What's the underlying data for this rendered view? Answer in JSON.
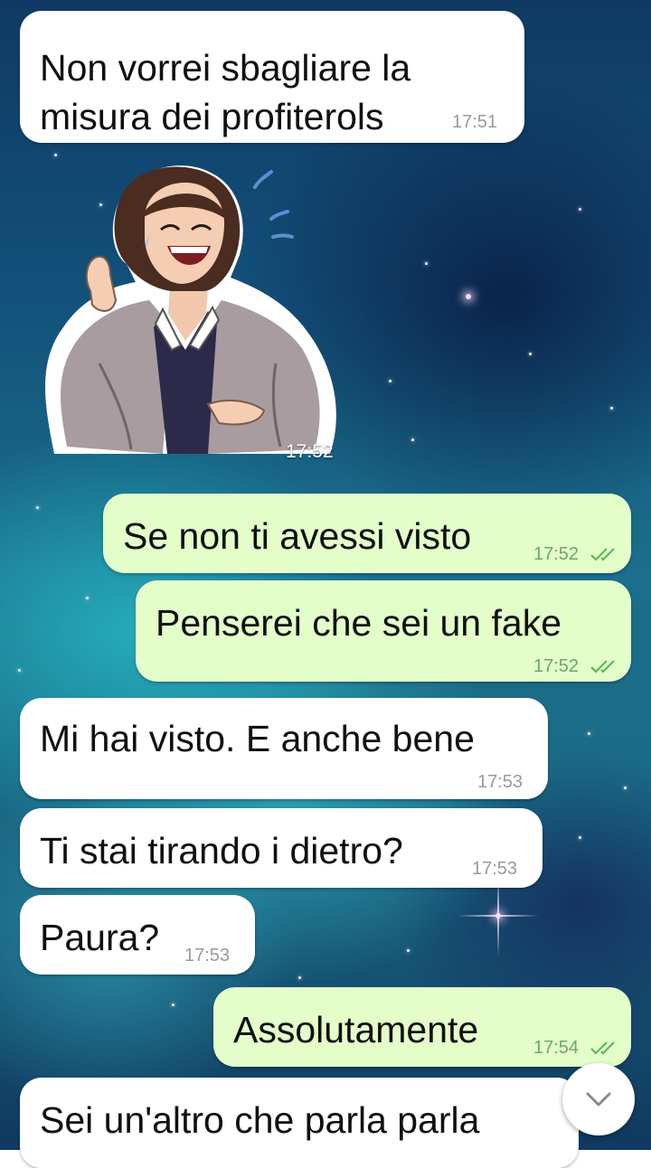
{
  "messages": [
    {
      "text_lines": [
        "Non vorrei sbagliare la",
        "misura dei profiterols"
      ],
      "time": "17:51",
      "direction": "incoming"
    },
    {
      "type": "sticker",
      "icon": "laughing-woman-sticker-icon",
      "time": "17:52",
      "direction": "incoming"
    },
    {
      "text": "Se non ti avessi visto",
      "time": "17:52",
      "direction": "outgoing",
      "status": "read"
    },
    {
      "text": "Penserei che sei un fake",
      "time": "17:52",
      "direction": "outgoing",
      "status": "read"
    },
    {
      "text": "Mi hai visto. E anche bene",
      "time": "17:53",
      "direction": "incoming"
    },
    {
      "text": "Ti stai tirando i dietro?",
      "time": "17:53",
      "direction": "incoming"
    },
    {
      "text": "Paura?",
      "time": "17:53",
      "direction": "incoming"
    },
    {
      "text": "Assolutamente",
      "time": "17:54",
      "direction": "outgoing",
      "status": "read"
    },
    {
      "text": "Sei un'altro che parla parla",
      "direction": "incoming"
    }
  ],
  "scroll_button": {
    "icon": "chevron-down-icon"
  },
  "colors": {
    "incoming_bubble": "#ffffff",
    "outgoing_bubble": "#e3fec9",
    "read_ticks": "#5fb65f",
    "time_incoming": "#9a9a9a"
  }
}
